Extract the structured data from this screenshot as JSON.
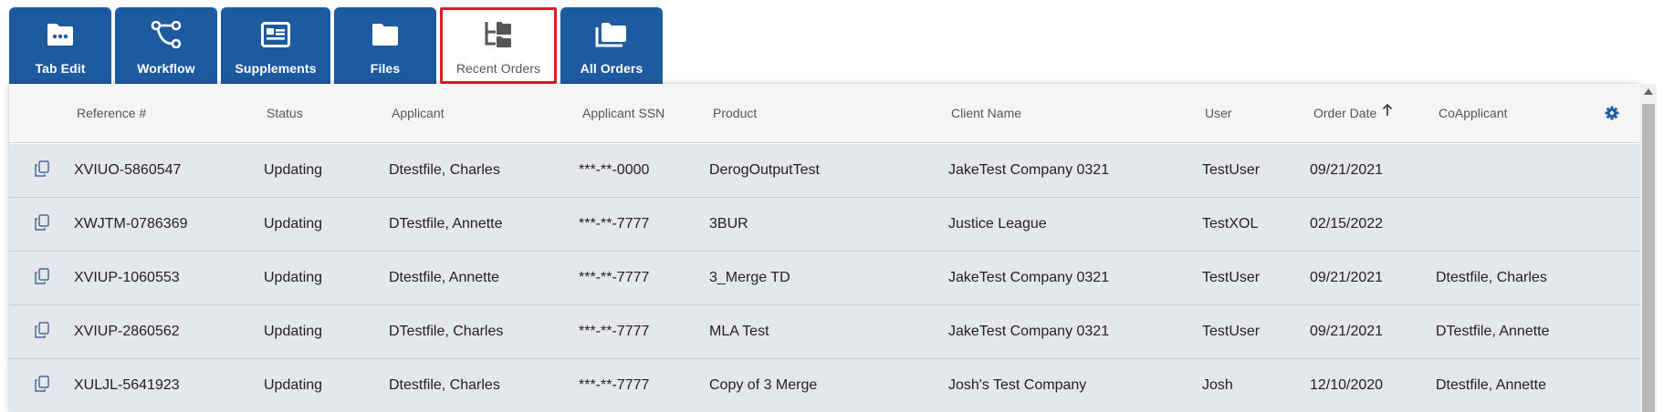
{
  "tabs": [
    {
      "label": "Tab Edit",
      "icon": "folder-dots-icon"
    },
    {
      "label": "Workflow",
      "icon": "workflow-icon"
    },
    {
      "label": "Supplements",
      "icon": "supplements-icon"
    },
    {
      "label": "Files",
      "icon": "folder-icon"
    },
    {
      "label": "Recent Orders",
      "icon": "recent-orders-icon",
      "active": true
    },
    {
      "label": "All Orders",
      "icon": "folders-stack-icon"
    }
  ],
  "grid": {
    "columns": {
      "reference": "Reference #",
      "status": "Status",
      "applicant": "Applicant",
      "ssn": "Applicant SSN",
      "product": "Product",
      "client": "Client Name",
      "user": "User",
      "order_date": "Order Date",
      "coapplicant": "CoApplicant"
    },
    "sort": {
      "column": "Order Date",
      "direction": "ascending"
    },
    "rows": [
      {
        "reference": "XVIUO-5860547",
        "status": "Updating",
        "applicant": "Dtestfile, Charles",
        "ssn": "***-**-0000",
        "product": "DerogOutputTest",
        "client": "JakeTest Company 0321",
        "user": "TestUser",
        "order_date": "09/21/2021",
        "coapplicant": ""
      },
      {
        "reference": "XWJTM-0786369",
        "status": "Updating",
        "applicant": "DTestfile, Annette",
        "ssn": "***-**-7777",
        "product": "3BUR",
        "client": "Justice League",
        "user": "TestXOL",
        "order_date": "02/15/2022",
        "coapplicant": ""
      },
      {
        "reference": "XVIUP-1060553",
        "status": "Updating",
        "applicant": "Dtestfile, Annette",
        "ssn": "***-**-7777",
        "product": "3_Merge TD",
        "client": "JakeTest Company 0321",
        "user": "TestUser",
        "order_date": "09/21/2021",
        "coapplicant": "Dtestfile, Charles"
      },
      {
        "reference": "XVIUP-2860562",
        "status": "Updating",
        "applicant": "DTestfile, Charles",
        "ssn": "***-**-7777",
        "product": "MLA Test",
        "client": "JakeTest Company 0321",
        "user": "TestUser",
        "order_date": "09/21/2021",
        "coapplicant": "DTestfile, Annette"
      },
      {
        "reference": "XULJL-5641923",
        "status": "Updating",
        "applicant": "Dtestfile, Charles",
        "ssn": "***-**-7777",
        "product": "Copy of 3 Merge",
        "client": "Josh's Test Company",
        "user": "Josh",
        "order_date": "12/10/2020",
        "coapplicant": "Dtestfile, Annette"
      }
    ]
  },
  "colors": {
    "tab_bg": "#1e5aa0",
    "active_outline": "#d2232a",
    "row_bg": "#e4e7ec",
    "header_bg": "#f5f5f5",
    "accent_icon": "#1e5aa0"
  }
}
